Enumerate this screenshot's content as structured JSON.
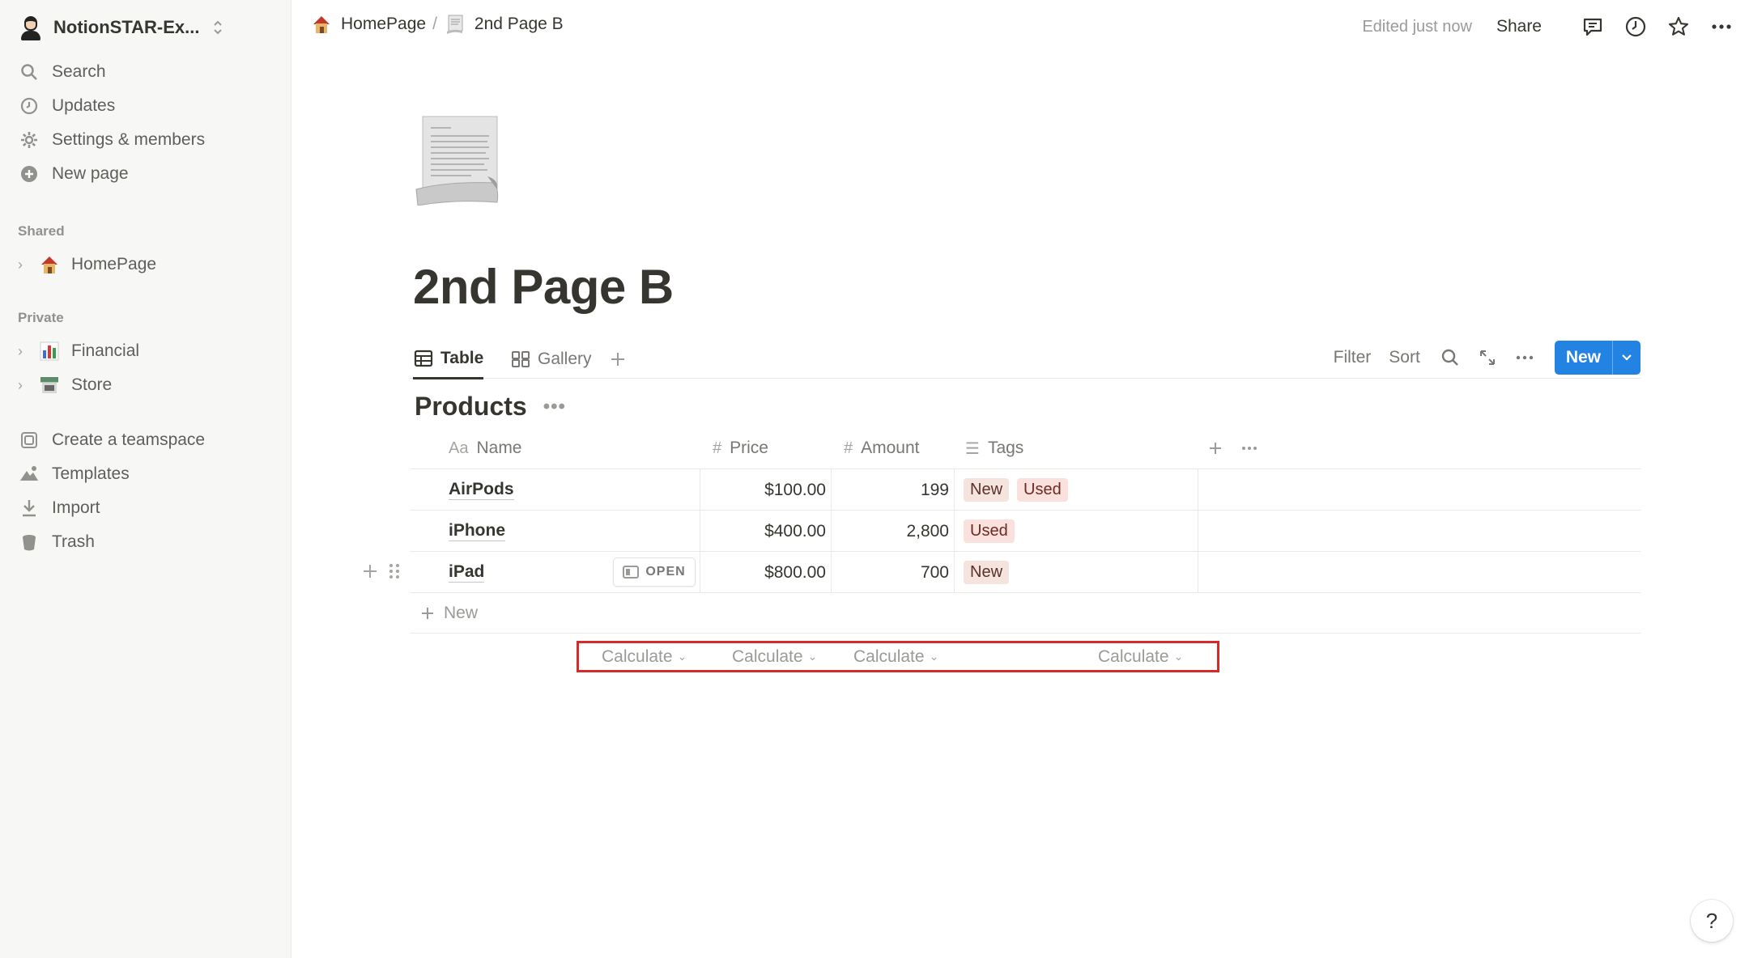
{
  "sidebar": {
    "workspace_name": "NotionSTAR-Ex...",
    "actions": [
      {
        "label": "Search",
        "icon": "search-icon"
      },
      {
        "label": "Updates",
        "icon": "clock-icon"
      },
      {
        "label": "Settings & members",
        "icon": "gear-icon"
      },
      {
        "label": "New page",
        "icon": "plus-circle-icon"
      }
    ],
    "shared_heading": "Shared",
    "shared_pages": [
      {
        "label": "HomePage",
        "emoji": "house-icon"
      }
    ],
    "private_heading": "Private",
    "private_pages": [
      {
        "label": "Financial",
        "emoji": "bar-chart-icon"
      },
      {
        "label": "Store",
        "emoji": "store-icon"
      }
    ],
    "footer": [
      {
        "label": "Create a teamspace",
        "icon": "teamspace-icon"
      },
      {
        "label": "Templates",
        "icon": "templates-icon"
      },
      {
        "label": "Import",
        "icon": "import-icon"
      },
      {
        "label": "Trash",
        "icon": "trash-icon"
      }
    ]
  },
  "topbar": {
    "breadcrumbs": [
      {
        "label": "HomePage",
        "emoji": "house-icon"
      },
      {
        "label": "2nd Page B",
        "emoji": "scroll-icon"
      }
    ],
    "separator": "/",
    "edited": "Edited just now",
    "share": "Share"
  },
  "page": {
    "title": "2nd Page B",
    "views": [
      {
        "label": "Table",
        "icon": "table-icon",
        "active": true
      },
      {
        "label": "Gallery",
        "icon": "gallery-icon",
        "active": false
      }
    ],
    "filter": "Filter",
    "sort": "Sort",
    "new_button": "New",
    "database_title": "Products",
    "columns": [
      {
        "label": "Name",
        "icon_text": "Aa"
      },
      {
        "label": "Price",
        "icon_text": "#"
      },
      {
        "label": "Amount",
        "icon_text": "#"
      },
      {
        "label": "Tags",
        "icon_text": "☰"
      }
    ],
    "rows": [
      {
        "name": "AirPods",
        "price": "$100.00",
        "amount": "199",
        "tags": [
          "New",
          "Used"
        ]
      },
      {
        "name": "iPhone",
        "price": "$400.00",
        "amount": "2,800",
        "tags": [
          "Used"
        ]
      },
      {
        "name": "iPad",
        "price": "$800.00",
        "amount": "700",
        "tags": [
          "New"
        ],
        "open_label": "OPEN"
      }
    ],
    "new_row": "New",
    "calculate": [
      "Calculate",
      "Calculate",
      "Calculate",
      "Calculate"
    ]
  },
  "colors": {
    "accent": "#2383e2",
    "highlight": "#d42a2a"
  },
  "help": "?"
}
